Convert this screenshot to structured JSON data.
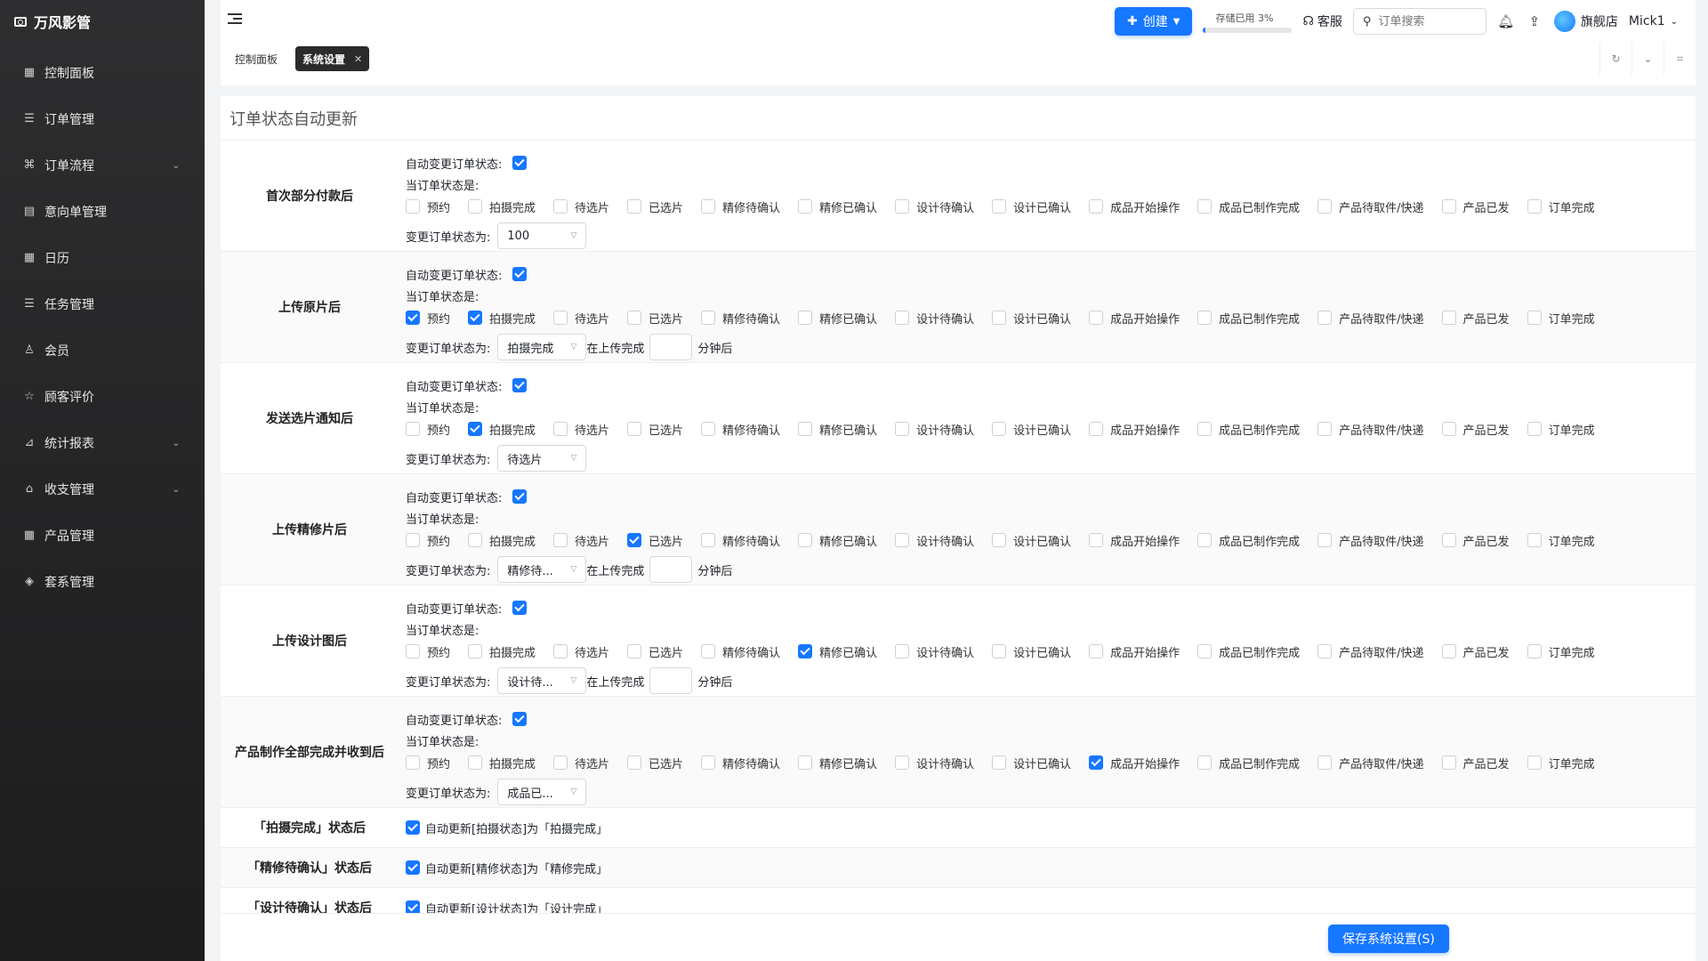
{
  "brand": "万风影管",
  "sidebar": {
    "items": [
      {
        "label": "控制面板",
        "icon": "grid-icon",
        "sym": "▦",
        "expand": false
      },
      {
        "label": "订单管理",
        "icon": "list-icon",
        "sym": "☰",
        "expand": false
      },
      {
        "label": "订单流程",
        "icon": "flow-icon",
        "sym": "⌘",
        "expand": true
      },
      {
        "label": "意向单管理",
        "icon": "document-icon",
        "sym": "▤",
        "expand": false
      },
      {
        "label": "日历",
        "icon": "calendar-icon",
        "sym": "▦",
        "expand": false
      },
      {
        "label": "任务管理",
        "icon": "task-list-icon",
        "sym": "☰",
        "expand": false
      },
      {
        "label": "会员",
        "icon": "user-icon",
        "sym": "♙",
        "expand": false
      },
      {
        "label": "顾客评价",
        "icon": "star-icon",
        "sym": "☆",
        "expand": false
      },
      {
        "label": "统计报表",
        "icon": "chart-icon",
        "sym": "⊿",
        "expand": true
      },
      {
        "label": "收支管理",
        "icon": "bank-icon",
        "sym": "⌂",
        "expand": true
      },
      {
        "label": "产品管理",
        "icon": "products-icon",
        "sym": "▦",
        "expand": false
      },
      {
        "label": "套系管理",
        "icon": "package-icon",
        "sym": "◈",
        "expand": false
      }
    ]
  },
  "header": {
    "create_label": "创建",
    "storage_label": "存储已用 3%",
    "storage_fill": 3,
    "support_label": "客服",
    "search_placeholder": "订单搜索",
    "store_label": "旗舰店",
    "user_label": "Mick1"
  },
  "tabs": [
    {
      "label": "控制面板"
    },
    {
      "label": "系统设置"
    }
  ],
  "section_title": "订单状态自动更新",
  "labels": {
    "auto_change": "自动变更订单状态:",
    "current_status": "当订单状态是:",
    "change_to": "变更订单状态为:",
    "upload_done": "在上传完成",
    "minutes_after": "分钟后"
  },
  "statuses": [
    "预约",
    "拍摄完成",
    "待选片",
    "已选片",
    "精修待确认",
    "精修已确认",
    "设计待确认",
    "设计已确认",
    "成品开始操作",
    "成品已制作完成",
    "产品待取件/快递",
    "产品已发",
    "订单完成"
  ],
  "rules": [
    {
      "name": "首次部分付款后",
      "checked": [],
      "select": "100",
      "upload_delay": false
    },
    {
      "name": "上传原片后",
      "checked": [
        0,
        1
      ],
      "select": "拍摄完成",
      "upload_delay": true
    },
    {
      "name": "发送选片通知后",
      "checked": [
        1
      ],
      "select": "待选片",
      "upload_delay": false
    },
    {
      "name": "上传精修片后",
      "checked": [
        3
      ],
      "select": "精修待...",
      "upload_delay": true
    },
    {
      "name": "上传设计图后",
      "checked": [
        5
      ],
      "select": "设计待...",
      "upload_delay": true
    },
    {
      "name": "产品制作全部完成并收到后",
      "checked": [
        8
      ],
      "select": "成品已...",
      "upload_delay": false
    }
  ],
  "simple_rules": [
    {
      "name": "「拍摄完成」状态后",
      "text": "自动更新[拍摄状态]为「拍摄完成」"
    },
    {
      "name": "「精修待确认」状态后",
      "text": "自动更新[精修状态]为「精修完成」"
    },
    {
      "name": "「设计待确认」状态后",
      "text": "自动更新[设计状态]为「设计完成」"
    }
  ],
  "save_label": "保存系统设置(S)",
  "colors": {
    "accent": "#1677ff",
    "sidebar": "#2a2a2b"
  }
}
